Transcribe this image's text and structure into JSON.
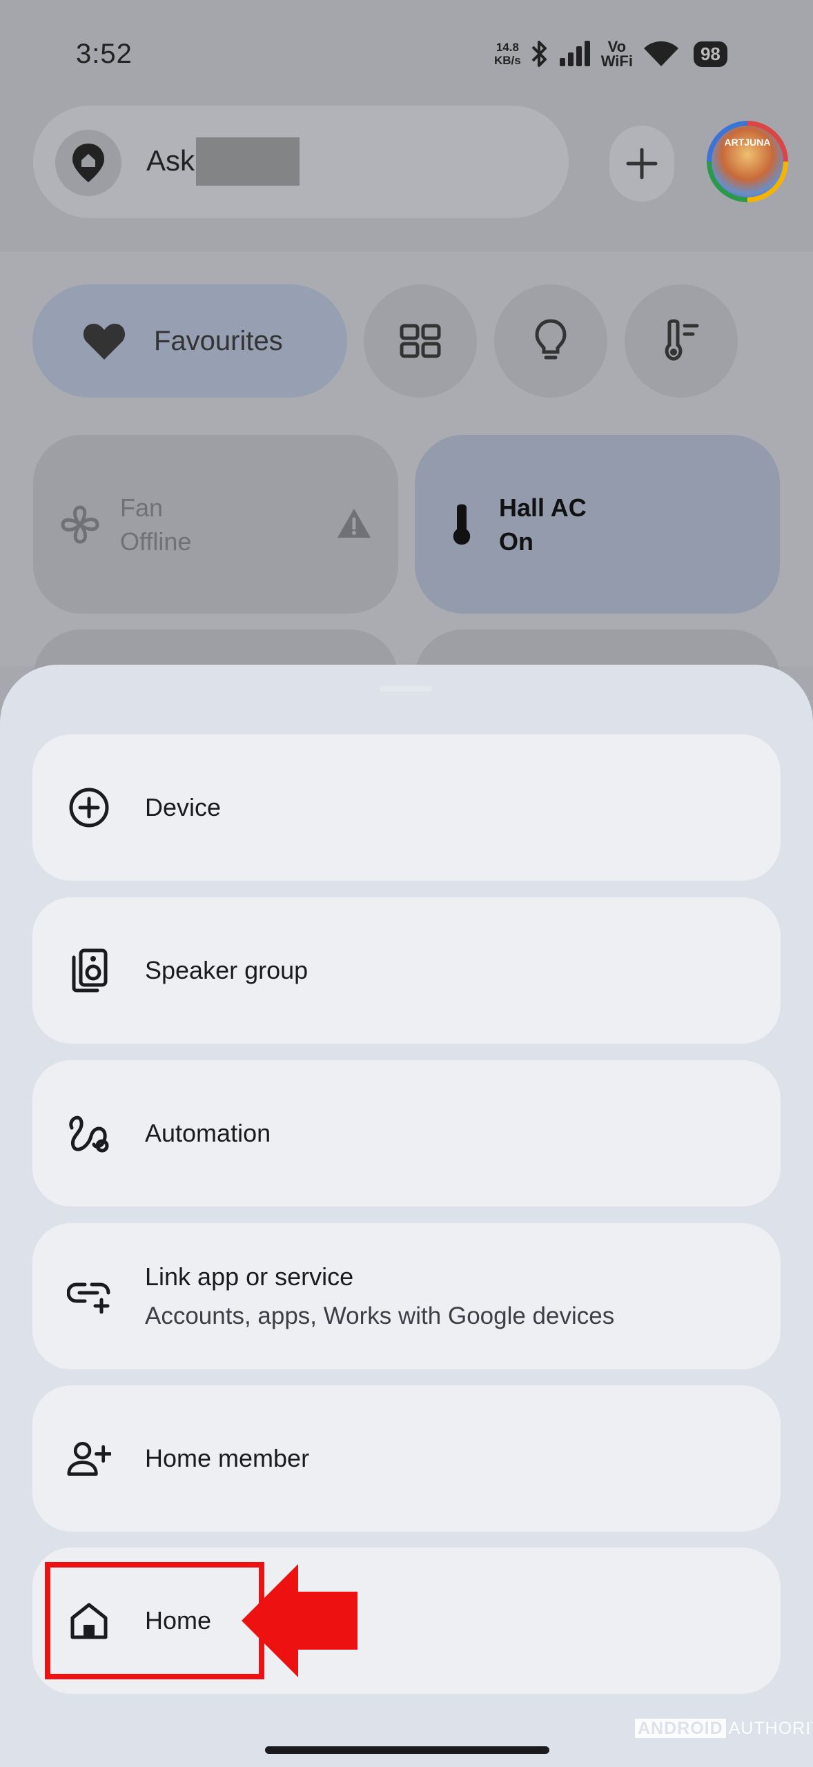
{
  "status_bar": {
    "time": "3:52",
    "speed_value": "14.8",
    "speed_unit": "KB/s",
    "volte_top": "Vo",
    "volte_bottom": "WiFi",
    "battery": "98"
  },
  "header": {
    "ask_text": "Ask",
    "avatar_text": "ARTJUNA"
  },
  "filters": {
    "favourites_label": "Favourites"
  },
  "tiles": [
    {
      "name": "Fan",
      "state": "Offline"
    },
    {
      "name": "Hall AC",
      "state": "On"
    }
  ],
  "sheet": {
    "items": [
      {
        "label": "Device",
        "icon": "add-circle-icon"
      },
      {
        "label": "Speaker group",
        "icon": "speaker-group-icon"
      },
      {
        "label": "Automation",
        "icon": "automation-icon"
      },
      {
        "label": "Link app or service",
        "sub": "Accounts, apps, Works with Google devices",
        "icon": "link-add-icon"
      },
      {
        "label": "Home member",
        "icon": "person-add-icon"
      },
      {
        "label": "Home",
        "icon": "home-icon"
      }
    ]
  },
  "colors": {
    "highlight": "#ee1111",
    "sheet_bg": "#dde2ea",
    "item_bg": "#eeeff3"
  },
  "watermark": {
    "brand_a": "ANDROID",
    "brand_b": "AUTHORITY"
  }
}
